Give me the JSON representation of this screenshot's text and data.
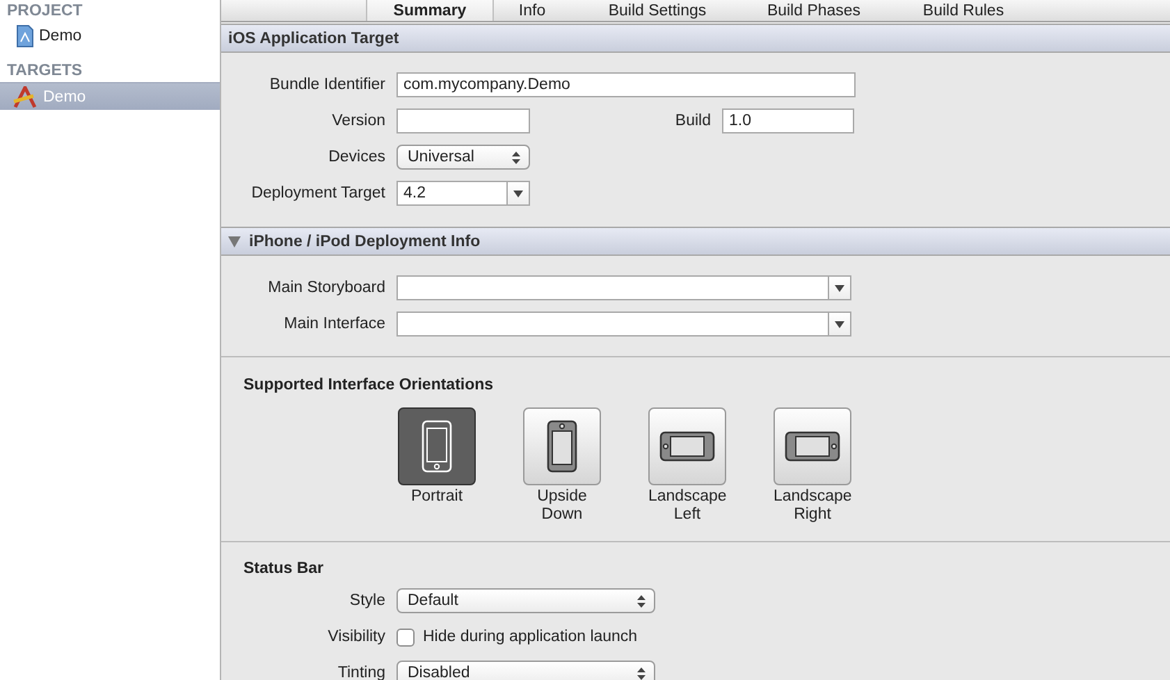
{
  "sidebar": {
    "groups": [
      {
        "title": "PROJECT",
        "items": [
          {
            "label": "Demo",
            "kind": "project",
            "selected": false
          }
        ]
      },
      {
        "title": "TARGETS",
        "items": [
          {
            "label": "Demo",
            "kind": "target",
            "selected": true
          }
        ]
      }
    ]
  },
  "tabs": [
    {
      "label": "Summary",
      "selected": true
    },
    {
      "label": "Info",
      "selected": false
    },
    {
      "label": "Build Settings",
      "selected": false
    },
    {
      "label": "Build Phases",
      "selected": false
    },
    {
      "label": "Build Rules",
      "selected": false
    }
  ],
  "sections": [
    {
      "kind": "header",
      "title": "iOS Application Target",
      "rows": [
        {
          "kind": "text",
          "label": "Bundle Identifier",
          "value": "com.mycompany.Demo"
        },
        {
          "kind": "text-pair",
          "fields": [
            {
              "label": "Version"
            },
            {
              "label": "Build",
              "value": "1.0"
            }
          ]
        },
        {
          "kind": "popup",
          "label": "Devices",
          "value": "Universal"
        },
        {
          "kind": "combo",
          "label": "Deployment Target",
          "value": "4.2"
        }
      ]
    },
    {
      "kind": "disclosure",
      "title": "iPhone / iPod Deployment Info",
      "expanded": true,
      "rows": [
        {
          "kind": "combo",
          "label": "Main Storyboard"
        },
        {
          "kind": "combo",
          "label": "Main Interface"
        }
      ]
    },
    {
      "kind": "orientations",
      "title": "Supported Interface Orientations",
      "items": [
        {
          "kind": "portrait",
          "label": "Portrait",
          "selected": true
        },
        {
          "kind": "upside-down",
          "label": "Upside Down",
          "selected": false
        },
        {
          "kind": "landscape-left",
          "label": "Landscape Left",
          "selected": false
        },
        {
          "kind": "landscape-right",
          "label": "Landscape Right",
          "selected": false
        }
      ]
    },
    {
      "kind": "group",
      "title": "Status Bar",
      "rows": [
        {
          "kind": "popup",
          "label": "Style",
          "value": "Default"
        },
        {
          "kind": "checkbox",
          "label": "Visibility",
          "text": "Hide during application launch",
          "checked": false
        },
        {
          "kind": "popup",
          "label": "Tinting",
          "value": "Disabled"
        }
      ]
    }
  ]
}
